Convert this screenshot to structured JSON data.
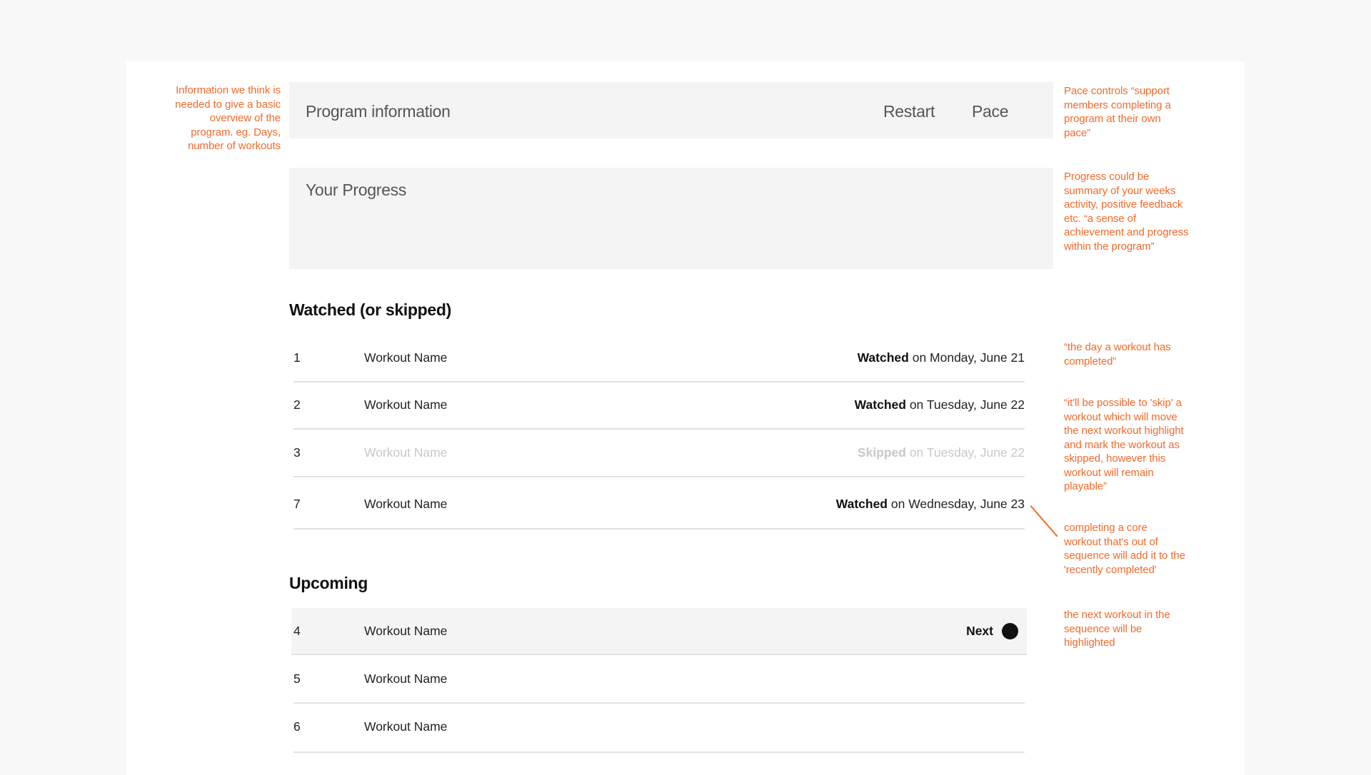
{
  "header_panel": {
    "title": "Program information",
    "restart_label": "Restart",
    "pace_label": "Pace"
  },
  "progress_panel": {
    "title": "Your Progress"
  },
  "watched_section": {
    "heading": "Watched (or skipped)",
    "rows": [
      {
        "number": "1",
        "name": "Workout Name",
        "status": "Watched",
        "date": " on Monday, June 21",
        "state": "watched"
      },
      {
        "number": "2",
        "name": "Workout Name",
        "status": "Watched",
        "date": " on Tuesday, June 22",
        "state": "watched"
      },
      {
        "number": "3",
        "name": "Workout Name",
        "status": "Skipped",
        "date": " on Tuesday, June 22",
        "state": "skipped"
      },
      {
        "number": "7",
        "name": "Workout Name",
        "status": "Watched",
        "date": " on Wednesday, June 23",
        "state": "watched"
      }
    ]
  },
  "upcoming_section": {
    "heading": "Upcoming",
    "rows": [
      {
        "number": "4",
        "name": "Workout Name",
        "status": "Next",
        "state": "next"
      },
      {
        "number": "5",
        "name": "Workout Name",
        "state": "upcoming"
      },
      {
        "number": "6",
        "name": "Workout Name",
        "state": "upcoming"
      }
    ]
  },
  "annotations": {
    "program_info": "Information we think is\nneeded to give a basic\noverview of the\nprogram. eg. Days,\nnumber of workouts",
    "pace": "Pace controls “support\nmembers completing a\nprogram at their own\npace”",
    "progress": "Progress could be\nsummary of your weeks\nactivity, positive feedback\netc. “a sense of\nachievement and progress\nwithin the program”",
    "completed_day": "“the day a workout has\ncompleted”",
    "skip": "“it'll be possible to 'skip' a\nworkout which will move\nthe next workout highlight\nand mark the workout as\nskipped, however this\nworkout will remain\nplayable”",
    "out_of_sequence": "completing a core\nworkout that's out of\nsequence will add it to the\n'recently completed'",
    "next_highlight": "the next workout in the\nsequence will be\nhighlighted"
  },
  "colors": {
    "annotation": "#f26a2a",
    "panel_bg": "#f4f4f4",
    "page_bg": "#f8f8f8",
    "skipped_text": "#c8c8c8",
    "next_dot": "#111111"
  },
  "icons": {
    "next_indicator": "filled-circle"
  }
}
